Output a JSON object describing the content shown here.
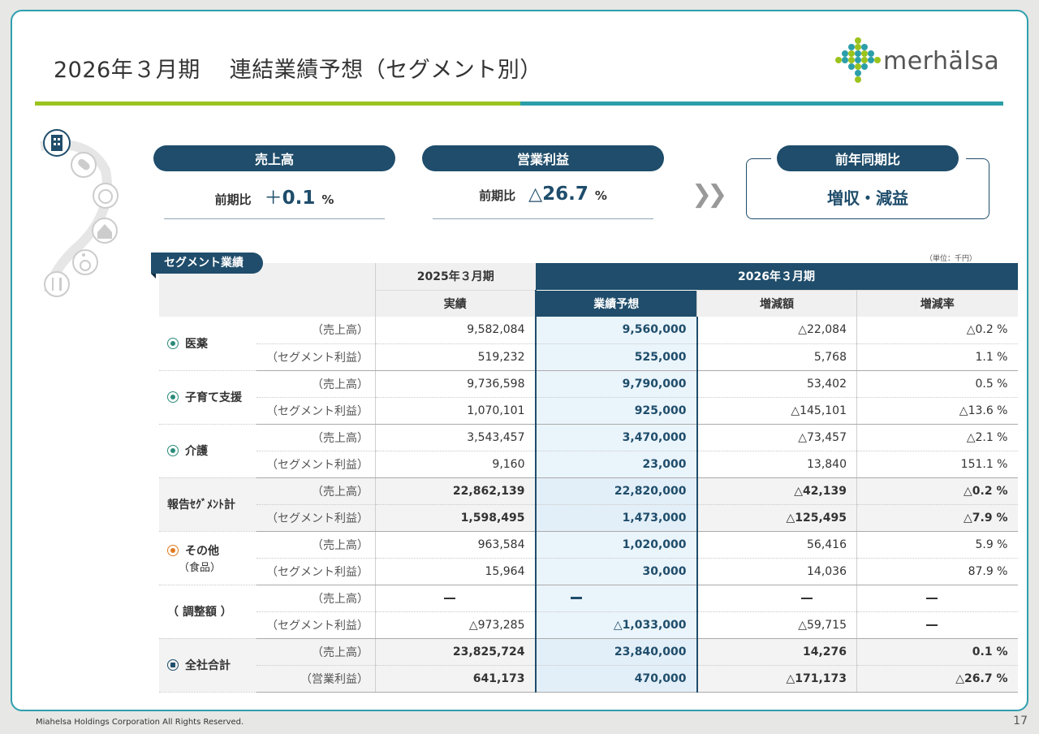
{
  "page": {
    "title_period": "2026年３月期",
    "title_main": "連結業績予想（セグメント別）",
    "logo_text": "merhälsa",
    "footer": "Miahelsa Holdings Corporation All Rights Reserved.",
    "page_number": "17",
    "brand_colors": {
      "navy": "#1f4d6b",
      "green": "#9bc31e",
      "teal": "#2b9fa9"
    }
  },
  "kpi": {
    "sales": {
      "label": "売上高",
      "compare_label": "前期比",
      "sign": "＋",
      "value": "0.1",
      "unit": "%"
    },
    "op_profit": {
      "label": "営業利益",
      "compare_label": "前期比",
      "sign": "△",
      "value": "26.7",
      "unit": "%"
    },
    "yoy": {
      "label": "前年同期比",
      "result": "増収・減益"
    }
  },
  "table": {
    "tag": "セグメント業績",
    "unit": "（単位：千円）",
    "header": {
      "fy2025": "2025年３月期",
      "fy2026": "2026年３月期",
      "actual": "実績",
      "forecast": "業績予想",
      "change": "増減額",
      "rate": "増減率"
    },
    "rows": [
      {
        "name": "医薬",
        "icon": "medicine-icon",
        "lines": [
          {
            "sub": "（売上高）",
            "actual": "9,582,084",
            "forecast": "9,560,000",
            "change": "△22,084",
            "rate": "△0.2 %"
          },
          {
            "sub": "（セグメント利益）",
            "actual": "519,232",
            "forecast": "525,000",
            "change": "5,768",
            "rate": "1.1 %"
          }
        ]
      },
      {
        "name": "子育て支援",
        "icon": "childcare-icon",
        "lines": [
          {
            "sub": "（売上高）",
            "actual": "9,736,598",
            "forecast": "9,790,000",
            "change": "53,402",
            "rate": "0.5 %"
          },
          {
            "sub": "（セグメント利益）",
            "actual": "1,070,101",
            "forecast": "925,000",
            "change": "△145,101",
            "rate": "△13.6 %"
          }
        ]
      },
      {
        "name": "介護",
        "icon": "nursing-care-icon",
        "lines": [
          {
            "sub": "（売上高）",
            "actual": "3,543,457",
            "forecast": "3,470,000",
            "change": "△73,457",
            "rate": "△2.1 %"
          },
          {
            "sub": "（セグメント利益）",
            "actual": "9,160",
            "forecast": "23,000",
            "change": "13,840",
            "rate": "151.1 %"
          }
        ]
      },
      {
        "name": "報告ｾｸﾞﾒﾝﾄ計",
        "icon": "",
        "lines": [
          {
            "sub": "（売上高）",
            "actual": "22,862,139",
            "forecast": "22,820,000",
            "change": "△42,139",
            "rate": "△0.2 %"
          },
          {
            "sub": "（セグメント利益）",
            "actual": "1,598,495",
            "forecast": "1,473,000",
            "change": "△125,495",
            "rate": "△7.9 %"
          }
        ]
      },
      {
        "name": "その他",
        "name2": "（食品）",
        "icon": "food-icon",
        "lines": [
          {
            "sub": "（売上高）",
            "actual": "963,584",
            "forecast": "1,020,000",
            "change": "56,416",
            "rate": "5.9 %"
          },
          {
            "sub": "（セグメント利益）",
            "actual": "15,964",
            "forecast": "30,000",
            "change": "14,036",
            "rate": "87.9 %"
          }
        ]
      },
      {
        "name": "（ 調整額 ）",
        "icon": "",
        "lines": [
          {
            "sub": "（売上高）",
            "actual": "—",
            "forecast": "—",
            "change": "—",
            "rate": "—"
          },
          {
            "sub": "（セグメント利益）",
            "actual": "△973,285",
            "forecast": "△1,033,000",
            "change": "△59,715",
            "rate": "—"
          }
        ]
      },
      {
        "name": "全社合計",
        "icon": "company-icon",
        "lines": [
          {
            "sub": "（売上高）",
            "actual": "23,825,724",
            "forecast": "23,840,000",
            "change": "14,276",
            "rate": "0.1 %"
          },
          {
            "sub": "（営業利益）",
            "actual": "641,173",
            "forecast": "470,000",
            "change": "△171,173",
            "rate": "△26.7 %"
          }
        ]
      }
    ]
  }
}
